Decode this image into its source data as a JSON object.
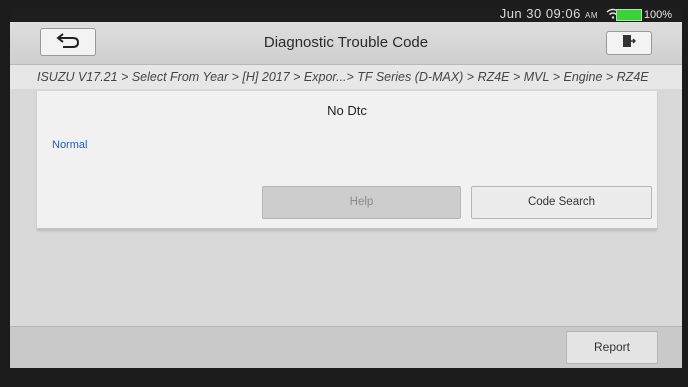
{
  "status_bar": {
    "time": "Jun 30  09:06",
    "ampm": "AM",
    "battery": "100%"
  },
  "header": {
    "title": "Diagnostic Trouble Code"
  },
  "breadcrumb": {
    "path": "ISUZU V17.21 > Select From Year > [H] 2017 > Expor...> TF Series (D-MAX) > RZ4E > MVL > Engine > RZ4E"
  },
  "main": {
    "dtc_status": "No Dtc",
    "system_status": "Normal",
    "help_label": "Help",
    "code_search_label": "Code Search"
  },
  "footer": {
    "report_label": "Report"
  },
  "icons": {
    "back": "back-arrow-icon",
    "exit": "exit-icon",
    "wifi": "wifi-icon"
  },
  "colors": {
    "status_text": "#1f5fbf",
    "battery": "#3bd13b"
  }
}
